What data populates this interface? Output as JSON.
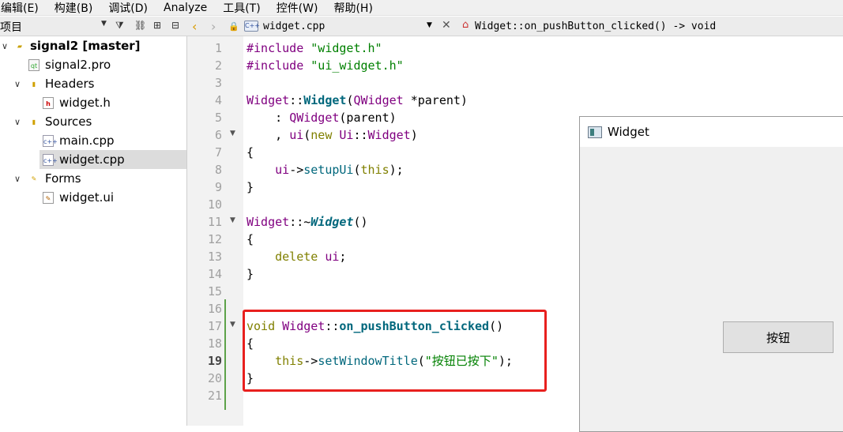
{
  "menu": [
    "编辑(E)",
    "构建(B)",
    "调试(D)",
    "Analyze",
    "工具(T)",
    "控件(W)",
    "帮助(H)"
  ],
  "project_panel": {
    "title": "项目",
    "tree": [
      {
        "label": "signal2 [master]",
        "level": 0,
        "expanded": true,
        "bold": true
      },
      {
        "label": "signal2.pro",
        "level": 1
      },
      {
        "label": "Headers",
        "level": 1,
        "expanded": true
      },
      {
        "label": "widget.h",
        "level": 2
      },
      {
        "label": "Sources",
        "level": 1,
        "expanded": true
      },
      {
        "label": "main.cpp",
        "level": 2
      },
      {
        "label": "widget.cpp",
        "level": 2,
        "selected": true
      },
      {
        "label": "Forms",
        "level": 1,
        "expanded": true
      },
      {
        "label": "widget.ui",
        "level": 2
      }
    ]
  },
  "editor_toolbar": {
    "file_badge": "C++",
    "file_name": "widget.cpp",
    "function_signature": "Widget::on_pushButton_clicked() -> void"
  },
  "editor": {
    "current_line": 19,
    "line_numbers": [
      "1",
      "2",
      "3",
      "4",
      "5",
      "6",
      "7",
      "8",
      "9",
      "10",
      "11",
      "12",
      "13",
      "14",
      "15",
      "16",
      "17",
      "18",
      "19",
      "20",
      "21"
    ]
  },
  "widget_window": {
    "title": "Widget",
    "button_label": "按钮"
  }
}
